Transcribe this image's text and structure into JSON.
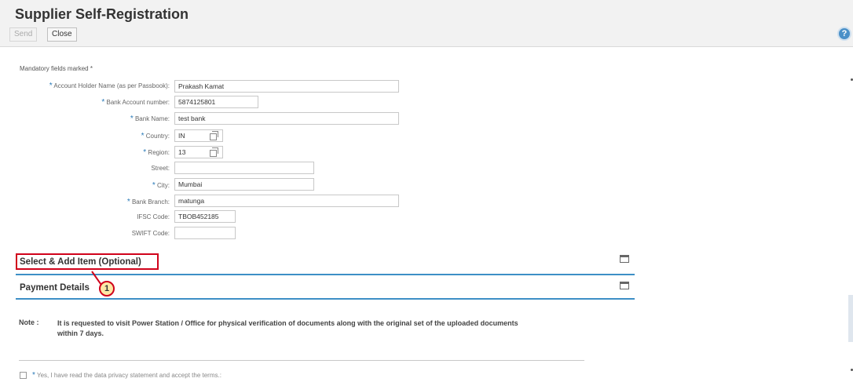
{
  "header": {
    "title": "Supplier Self-Registration",
    "send_label": "Send",
    "close_label": "Close",
    "help_icon": "help-icon"
  },
  "form": {
    "mandatory_note": "Mandatory fields marked *",
    "fields": {
      "account_holder": {
        "label": "Account Holder Name (as per Passbook):",
        "value": "Prakash Kamat"
      },
      "account_number": {
        "label": "Bank Account number:",
        "value": "5874125801"
      },
      "bank_name": {
        "label": "Bank Name:",
        "value": "test bank"
      },
      "country": {
        "label": "Country:",
        "value": "IN"
      },
      "region": {
        "label": "Region:",
        "value": "13"
      },
      "street": {
        "label": "Street:",
        "value": ""
      },
      "city": {
        "label": "City:",
        "value": "Mumbai"
      },
      "bank_branch": {
        "label": "Bank Branch:",
        "value": "matunga"
      },
      "ifsc": {
        "label": "IFSC Code:",
        "value": "TBOB452185"
      },
      "swift": {
        "label": "SWIFT Code:",
        "value": ""
      }
    },
    "required_marker": "*"
  },
  "sections": {
    "select_add": "Select & Add Item (Optional)",
    "payment": "Payment Details"
  },
  "callout": {
    "number": "1"
  },
  "note": {
    "label": "Note :",
    "text": "It is requested to visit Power Station / Office for physical verification of documents along with the original set of the uploaded documents within 7 days."
  },
  "terms": {
    "text": "Yes, I have read the data privacy statement and accept the terms.:"
  },
  "colors": {
    "accent": "#3d8fc6",
    "required": "#2a7ab8",
    "highlight": "#d0021b"
  }
}
